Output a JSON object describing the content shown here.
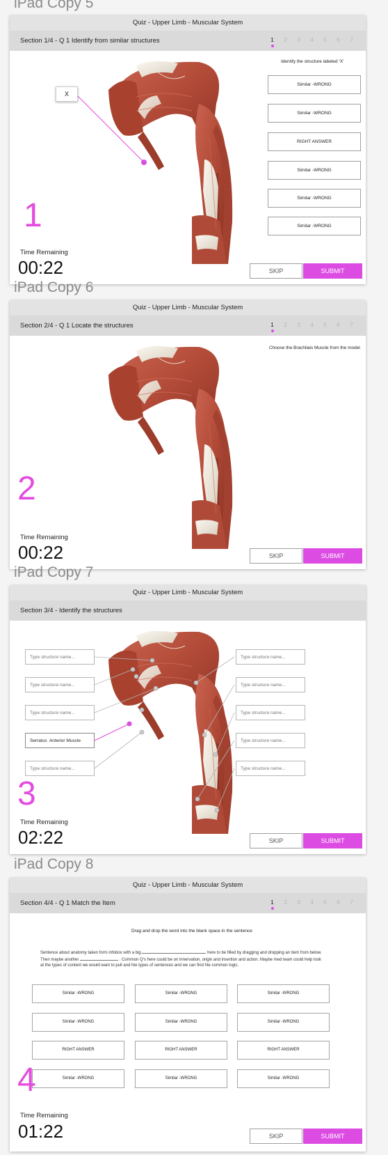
{
  "screens": [
    {
      "label": "iPad Copy 5",
      "app_title": "Quiz - Upper Limb - Muscular System",
      "section_title": "Section 1/4 - Q 1 Identify from similar structures",
      "pager": [
        "1",
        "2",
        "3",
        "4",
        "5",
        "6",
        "7"
      ],
      "instruction": "Identify the structure labeled 'X'",
      "marker_label": "X",
      "answers": [
        "Similar -WRONG",
        "Similar -WRONG",
        "RIGHT ANSWER",
        "Similar -WRONG",
        "Similar -WRONG",
        "Similar -WRONG"
      ],
      "number": "1",
      "time_label": "Time Remaining",
      "time_value": "00:22",
      "skip_label": "SKIP",
      "submit_label": "SUBMIT"
    },
    {
      "label": "iPad Copy 6",
      "app_title": "Quiz - Upper Limb - Muscular System",
      "section_title": "Section 2/4 - Q 1 Locate the structures",
      "pager": [
        "1",
        "2",
        "3",
        "4",
        "5",
        "6",
        "7"
      ],
      "instruction": "Choose the Brachilais Muscle from the model",
      "number": "2",
      "time_label": "Time Remaining",
      "time_value": "00:22",
      "skip_label": "SKIP",
      "submit_label": "SUBMIT"
    },
    {
      "label": "iPad Copy 7",
      "app_title": "Quiz - Upper Limb - Muscular System",
      "section_title": "Section 3/4 - Identify the structures",
      "placeholder": "Type structure name...",
      "filled_value": "Serratus  Anterior Muscle",
      "number": "3",
      "time_label": "Time Remaining",
      "time_value": "02:22",
      "skip_label": "SKIP",
      "submit_label": "SUBMIT"
    },
    {
      "label": "iPad Copy 8",
      "app_title": "Quiz - Upper Limb - Muscular System",
      "section_title": "Section 4/4 - Q 1 Match the Item",
      "pager": [
        "1",
        "2",
        "3",
        "4",
        "5",
        "6",
        "7"
      ],
      "instruction": "Drag and drop the word into the blank space in the sentence",
      "sentence_part1": "Sentence about anatomy taken form infobox with a big",
      "sentence_part2": "here to be filled by dragging and dropping an item from below. Then maybe another",
      "sentence_part3": ". Common Q's here could be on innervation, origin and insertion and action. Maybe med team could help look at the types of content we would want to pull and hte types of sentences and we can find hte common logic.",
      "grid": [
        [
          "Similar -WRONG",
          "Similar -WRONG",
          "Similar -WRONG"
        ],
        [
          "Similar -WRONG",
          "Similar -WRONG",
          "Similar -WRONG"
        ],
        [
          "RIGHT ANSWER",
          "RIGHT ANSWER",
          "RIGHT ANSWER"
        ],
        [
          "Similar -WRONG",
          "Similar -WRONG",
          "Similar -WRONG"
        ]
      ],
      "number": "4",
      "time_label": "Time Remaining",
      "time_value": "01:22",
      "skip_label": "SKIP",
      "submit_label": "SUBMIT"
    }
  ],
  "colors": {
    "accent": "#dc4ce3",
    "muscle": "#b9513f",
    "tendon": "#eee6d8",
    "bar": "#dadada"
  },
  "icons": [
    "arm-muscle-model",
    "label-marker-dot",
    "pager-active-dot"
  ]
}
